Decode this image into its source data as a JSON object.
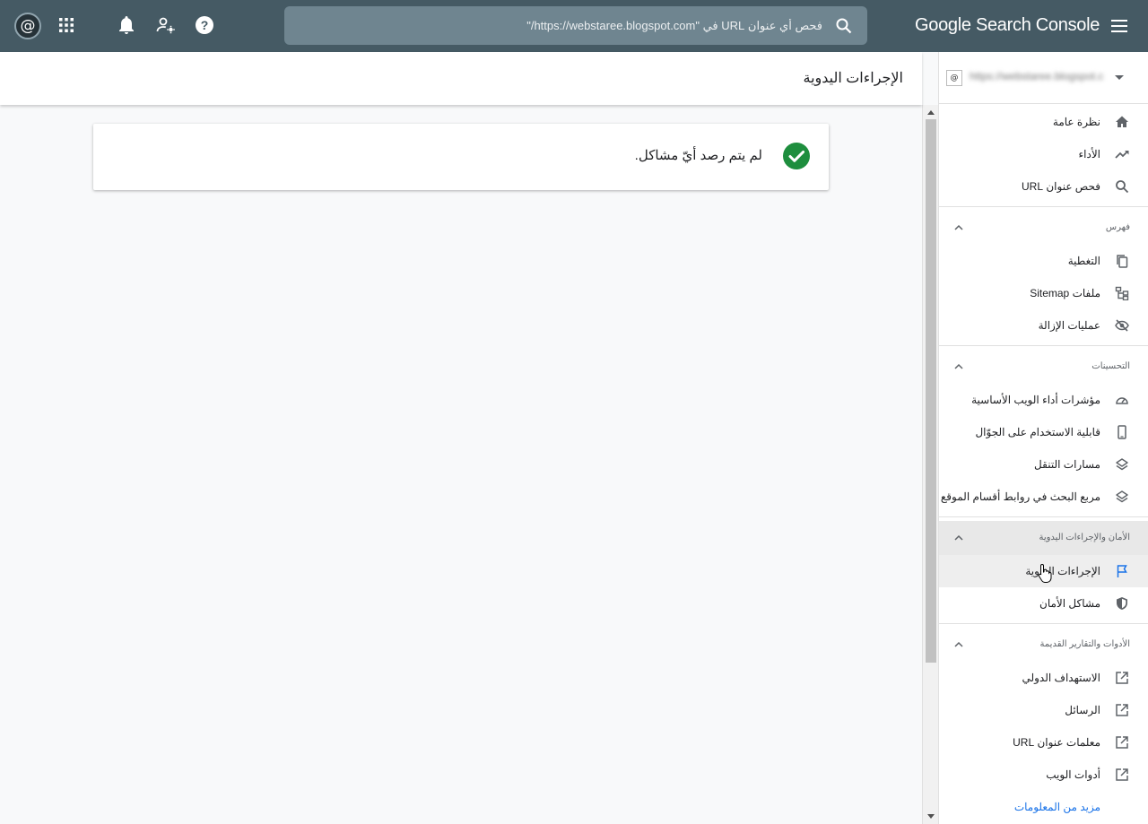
{
  "topbar": {
    "avatar_char": "@",
    "brand": "Google Search Console",
    "search_placeholder": "فحص أي عنوان URL في \"https://webstaree.blogspot.com/\"",
    "icons": [
      "apps-icon",
      "notifications-icon",
      "account-settings-icon",
      "help-icon",
      "search-icon",
      "menu-icon"
    ]
  },
  "main": {
    "title": "الإجراءات اليدوية",
    "status_message": "لم يتم رصد أيّ مشاكل."
  },
  "sidebar": {
    "property_name": "https://webstaree.blogspot.com/",
    "property_favicon": "@",
    "top_items": [
      {
        "label": "نظرة عامة",
        "icon": "home-icon"
      },
      {
        "label": "الأداء",
        "icon": "trending-up-icon"
      },
      {
        "label": "فحص عنوان URL",
        "icon": "search-icon"
      }
    ],
    "sections": [
      {
        "title": "فهرس",
        "items": [
          {
            "label": "التغطية",
            "icon": "copy-icon"
          },
          {
            "label": "ملفات Sitemap",
            "icon": "sitemap-icon"
          },
          {
            "label": "عمليات الإزالة",
            "icon": "visibility-off-icon"
          }
        ]
      },
      {
        "title": "التحسينات",
        "items": [
          {
            "label": "مؤشرات أداء الويب الأساسية",
            "icon": "speed-icon"
          },
          {
            "label": "قابلية الاستخدام على الجوّال",
            "icon": "phone-icon"
          },
          {
            "label": "مسارات التنقل",
            "icon": "layers-icon"
          },
          {
            "label": "مربع البحث في روابط أقسام الموقع",
            "icon": "layers-icon"
          }
        ]
      },
      {
        "title": "الأمان والإجراءات اليدوية",
        "items": [
          {
            "label": "الإجراءات اليدوية",
            "icon": "flag-icon"
          },
          {
            "label": "مشاكل الأمان",
            "icon": "shield-icon"
          }
        ]
      },
      {
        "title": "الأدوات والتقارير القديمة",
        "items": [
          {
            "label": "الاستهداف الدولي",
            "icon": "open-in-new-icon"
          },
          {
            "label": "الرسائل",
            "icon": "open-in-new-icon"
          },
          {
            "label": "معلمات عنوان URL",
            "icon": "open-in-new-icon"
          },
          {
            "label": "أدوات الويب",
            "icon": "open-in-new-icon"
          }
        ]
      }
    ],
    "more_link": "مزيد من المعلومات"
  },
  "colors": {
    "topbar": "#455a64",
    "search_bg": "#6f8590",
    "success_green": "#1e8e3e",
    "active_bg": "#eeeeee",
    "link": "#1a73e8"
  }
}
